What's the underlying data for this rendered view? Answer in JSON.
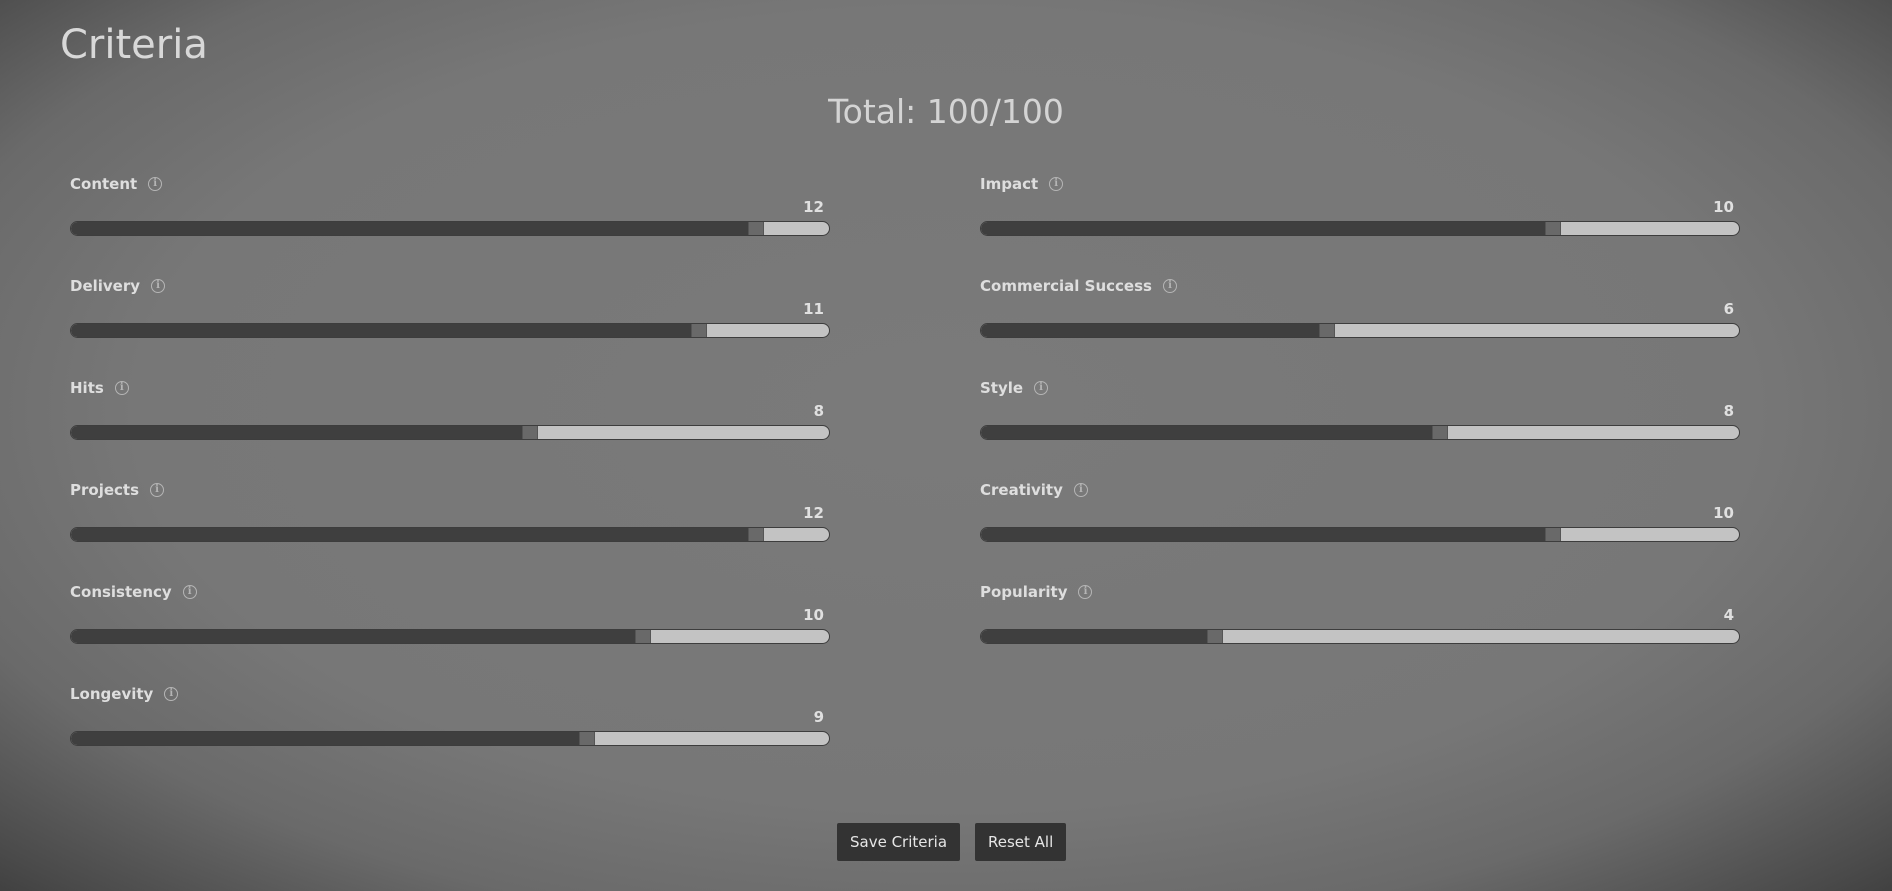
{
  "page": {
    "title": "Criteria",
    "total_label": "Total: 100/100"
  },
  "slider_max": 100,
  "criteria_left": [
    {
      "label": "Content",
      "value": 12
    },
    {
      "label": "Delivery",
      "value": 11
    },
    {
      "label": "Hits",
      "value": 8
    },
    {
      "label": "Projects",
      "value": 12
    },
    {
      "label": "Consistency",
      "value": 10
    },
    {
      "label": "Longevity",
      "value": 9
    }
  ],
  "criteria_right": [
    {
      "label": "Impact",
      "value": 10
    },
    {
      "label": "Commercial Success",
      "value": 6
    },
    {
      "label": "Style",
      "value": 8
    },
    {
      "label": "Creativity",
      "value": 10
    },
    {
      "label": "Popularity",
      "value": 4
    }
  ],
  "info_icon_glyph": "i",
  "buttons": {
    "save_label": "Save Criteria",
    "reset_label": "Reset All"
  },
  "colors": {
    "track": "#c3c3c3",
    "fill": "#3f3f3f",
    "thumb": "#696969",
    "button_bg": "#333333"
  }
}
